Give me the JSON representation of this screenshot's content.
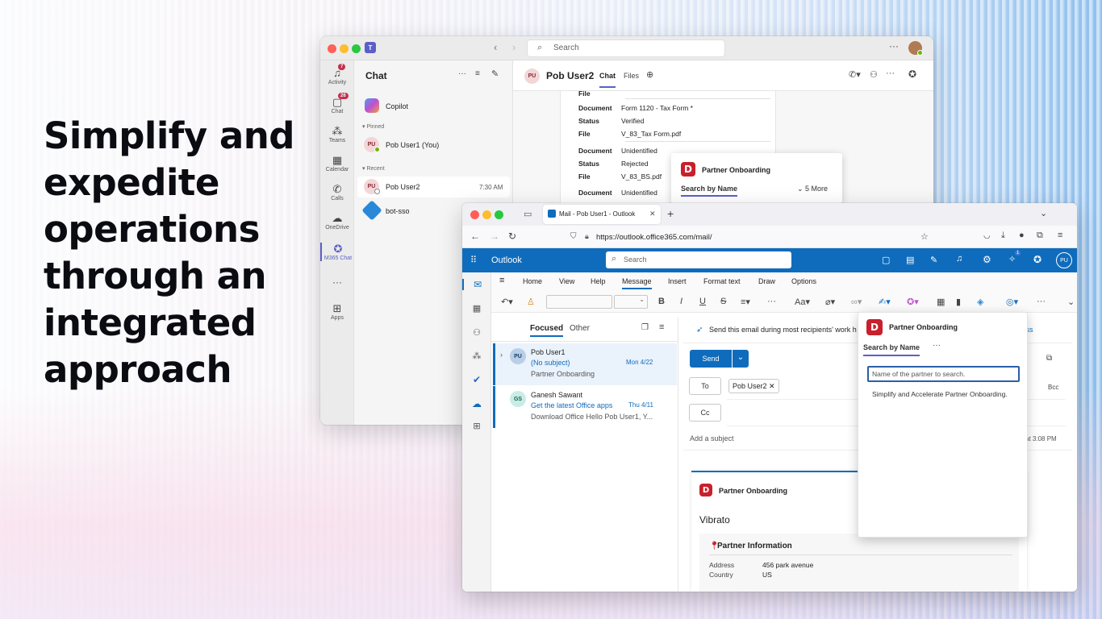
{
  "headline": "Simplify and expedite operations through an integrated approach",
  "teams": {
    "search_placeholder": "Search",
    "rail": [
      {
        "label": "Activity",
        "icon": "bell-icon",
        "badge": "7"
      },
      {
        "label": "Chat",
        "icon": "chat-icon",
        "badge": "26"
      },
      {
        "label": "Teams",
        "icon": "teams-icon",
        "badge": ""
      },
      {
        "label": "Calendar",
        "icon": "calendar-icon",
        "badge": ""
      },
      {
        "label": "Calls",
        "icon": "phone-icon",
        "badge": ""
      },
      {
        "label": "OneDrive",
        "icon": "cloud-icon",
        "badge": ""
      },
      {
        "label": "M365 Chat",
        "icon": "copilot-icon",
        "badge": ""
      },
      {
        "label": "Apps",
        "icon": "plus-square-icon",
        "badge": ""
      }
    ],
    "list_title": "Chat",
    "copilot": "Copilot",
    "pinned_label": "Pinned",
    "recent_label": "Recent",
    "chats": [
      {
        "initials": "PU",
        "name": "Pob User1 (You)",
        "time": ""
      },
      {
        "initials": "PU",
        "name": "Pob User2",
        "time": "7:30 AM"
      },
      {
        "initials": "",
        "name": "bot-sso",
        "time": ""
      }
    ],
    "conversation": {
      "initials": "PU",
      "name": "Pob User2",
      "tabs": [
        "Chat",
        "Files"
      ]
    },
    "card_fields": [
      {
        "key": "File",
        "value": ""
      },
      {
        "key": "Document",
        "value": "Form 1120 - Tax Form *"
      },
      {
        "key": "Status",
        "value": "Verified"
      },
      {
        "key": "File",
        "value": "V_83_Tax Form.pdf"
      },
      {
        "key": "Document",
        "value": "Unidentified"
      },
      {
        "key": "Status",
        "value": "Rejected"
      },
      {
        "key": "File",
        "value": "V_83_BS.pdf"
      },
      {
        "key": "Document",
        "value": "Unidentified"
      }
    ],
    "popup": {
      "logo": "D",
      "title": "Partner Onboarding",
      "tab": "Search by Name",
      "more": "5 More"
    }
  },
  "browser": {
    "tab_title": "Mail - Pob User1 - Outlook",
    "url": "https://outlook.office365.com/mail/"
  },
  "outlook": {
    "brand": "Outlook",
    "search_placeholder": "Search",
    "notification_count": "1",
    "user_initials": "PU",
    "menu": [
      "Home",
      "View",
      "Help",
      "Message",
      "Insert",
      "Format text",
      "Draw",
      "Options"
    ],
    "active_menu": "Message",
    "list_tabs": [
      "Focused",
      "Other"
    ],
    "mails": [
      {
        "initials": "PU",
        "from": "Pob User1",
        "subject": "(No subject)",
        "date": "Mon 4/22",
        "preview": "Partner Onboarding"
      },
      {
        "initials": "GS",
        "from": "Ganesh Sawant",
        "subject": "Get the latest Office apps",
        "date": "Thu 4/11",
        "preview": "Download Office Hello Pob User1, Y..."
      }
    ],
    "compose": {
      "info": "Send this email during most recipients' work h",
      "dismiss": "Dismiss",
      "send": "Send",
      "to_label": "To",
      "cc_label": "Cc",
      "bcc_label": "Bcc",
      "recipient": "Pob User2",
      "subject_placeholder": "Add a subject",
      "draft_time": "at 3:08 PM",
      "body_card_title": "Partner Onboarding",
      "body_company": "Vibrato",
      "section_title": "Partner Information",
      "address_label": "Address",
      "address_value": "456 park avenue",
      "country_label": "Country",
      "country_value": "US"
    },
    "pane": {
      "title": "Partner Onboarding",
      "tab": "Search by Name",
      "input_placeholder": "Name of the partner to search.",
      "description": "Simplify and Accelerate Partner Onboarding."
    }
  }
}
